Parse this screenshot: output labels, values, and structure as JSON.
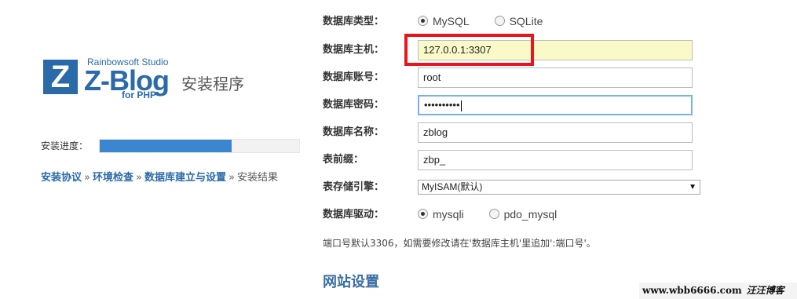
{
  "logo": {
    "letter": "Z",
    "studio": "Rainbowsoft Studio",
    "brand": "Z-Blog",
    "for_php": "for PHP",
    "title": "安装程序"
  },
  "progress": {
    "label": "安装进度：",
    "fraction": 0.66,
    "fill_color": "#3a87cf"
  },
  "steps": [
    {
      "label": "安装协议",
      "state": "done"
    },
    {
      "label": "环境检查",
      "state": "done"
    },
    {
      "label": "数据库建立与设置",
      "state": "done"
    },
    {
      "label": "安装结果",
      "state": "current"
    }
  ],
  "step_separator": "»",
  "form": {
    "db_type": {
      "label": "数据库类型：",
      "options": [
        {
          "label": "MySQL",
          "checked": true
        },
        {
          "label": "SQLite",
          "checked": false
        }
      ]
    },
    "db_host": {
      "label": "数据库主机：",
      "value": "127.0.0.1:3307"
    },
    "db_user": {
      "label": "数据库账号：",
      "value": "root"
    },
    "db_pass": {
      "label": "数据库密码：",
      "value": "••••••••••"
    },
    "db_name": {
      "label": "数据库名称：",
      "value": "zblog"
    },
    "table_prefix": {
      "label": "表前缀：",
      "value": "zbp_"
    },
    "engine": {
      "label": "表存储引擎：",
      "value": "MyISAM(默认)"
    },
    "driver": {
      "label": "数据库驱动：",
      "options": [
        {
          "label": "mysqli",
          "checked": true
        },
        {
          "label": "pdo_mysql",
          "checked": false
        }
      ]
    }
  },
  "note": "端口号默认3306，如需要修改请在'数据库主机'里追加':端口号'。",
  "section_title": "网站设置",
  "highlight_color": "#e8161c",
  "watermark": {
    "url": "www.wbb6666.com",
    "signature": "汪汪博客"
  }
}
